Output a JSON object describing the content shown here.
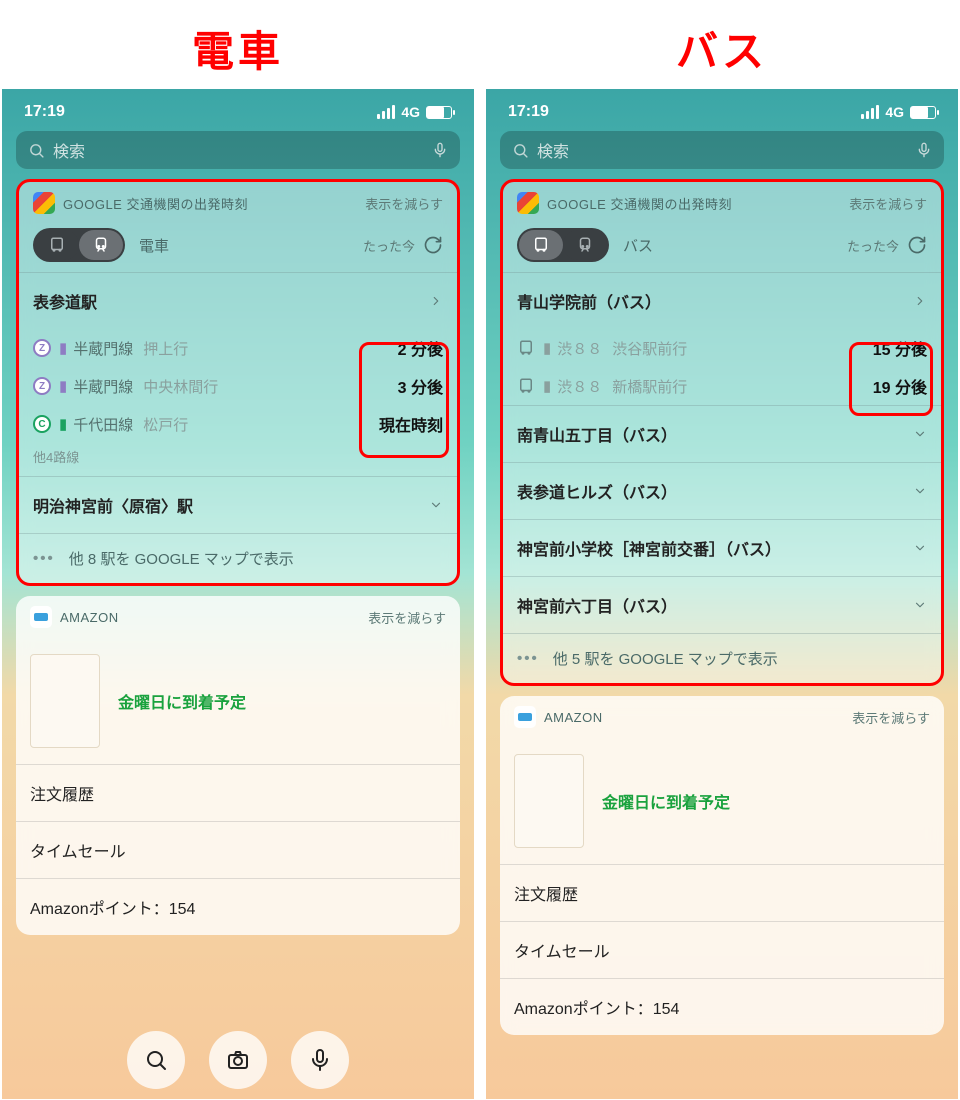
{
  "titles": {
    "left": "電車",
    "right": "バス"
  },
  "status": {
    "time": "17:19",
    "network": "4G"
  },
  "search": {
    "placeholder": "検索"
  },
  "google_widget": {
    "title": "GOOGLE 交通機関の出発時刻",
    "reduce": "表示を減らす",
    "toggle_modes": {
      "train": "電車",
      "bus": "バス"
    },
    "justnow": "たった今",
    "more_train": "他 8 駅を GOOGLE マップで表示",
    "more_bus": "他 5 駅を GOOGLE マップで表示"
  },
  "train": {
    "station1": "表参道駅",
    "lines": [
      {
        "code": "Z",
        "line": "半蔵門線",
        "dest": "押上行",
        "due": "2 分後"
      },
      {
        "code": "Z",
        "line": "半蔵門線",
        "dest": "中央林間行",
        "due": "3 分後"
      },
      {
        "code": "C",
        "line": "千代田線",
        "dest": "松戸行",
        "due": "現在時刻"
      }
    ],
    "other_lines": "他4路線",
    "station2": "明治神宮前〈原宿〉駅"
  },
  "bus": {
    "station1": "青山学院前（バス）",
    "lines": [
      {
        "route": "渋８８",
        "dest": "渋谷駅前行",
        "due": "15 分後"
      },
      {
        "route": "渋８８",
        "dest": "新橋駅前行",
        "due": "19 分後"
      }
    ],
    "collapsed": [
      "南青山五丁目（バス）",
      "表参道ヒルズ（バス）",
      "神宮前小学校［神宮前交番］（バス）",
      "神宮前六丁目（バス）"
    ]
  },
  "amazon": {
    "title": "AMAZON",
    "reduce": "表示を減らす",
    "arrival": "金曜日に到着予定",
    "links": [
      "注文履歴",
      "タイムセール",
      "Amazonポイント：154"
    ]
  }
}
